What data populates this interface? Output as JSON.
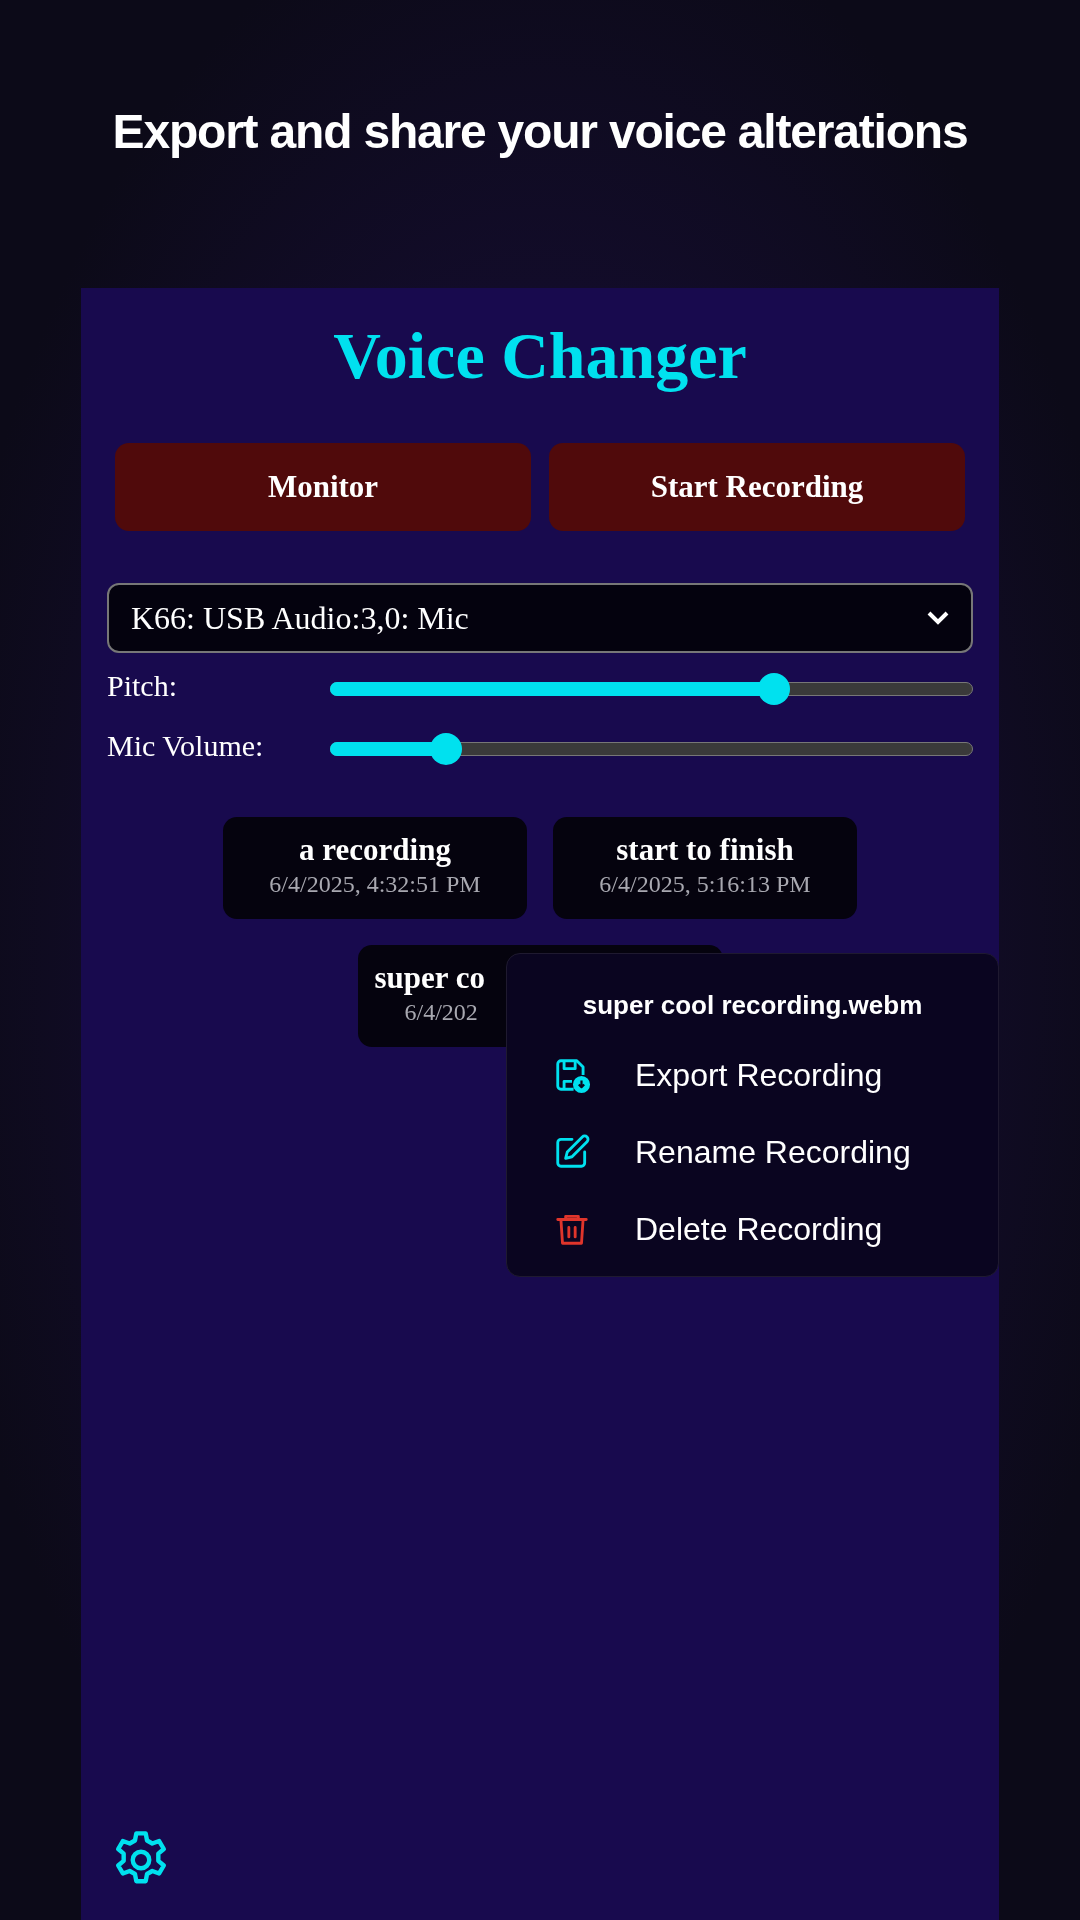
{
  "caption": "Export and share your voice alterations",
  "app": {
    "title": "Voice Changer",
    "buttons": [
      "Monitor",
      "Start Recording"
    ],
    "device_select": {
      "value": "K66: USB Audio:3,0: Mic"
    },
    "sliders": [
      {
        "label": "Pitch:",
        "level": 0.69
      },
      {
        "label": "Mic Volume:",
        "level": 0.18
      }
    ],
    "recordings": [
      {
        "name": "a recording",
        "date": "6/4/2025, 4:32:51 PM"
      },
      {
        "name": "start to finish",
        "date": "6/4/2025, 5:16:13 PM"
      },
      {
        "name": "super co",
        "date": "6/4/202"
      }
    ],
    "context_menu": {
      "title": "super cool recording.webm",
      "items": [
        {
          "kind": "export",
          "label": "Export Recording"
        },
        {
          "kind": "rename",
          "label": "Rename Recording"
        },
        {
          "kind": "delete",
          "label": "Delete Recording"
        }
      ]
    }
  }
}
